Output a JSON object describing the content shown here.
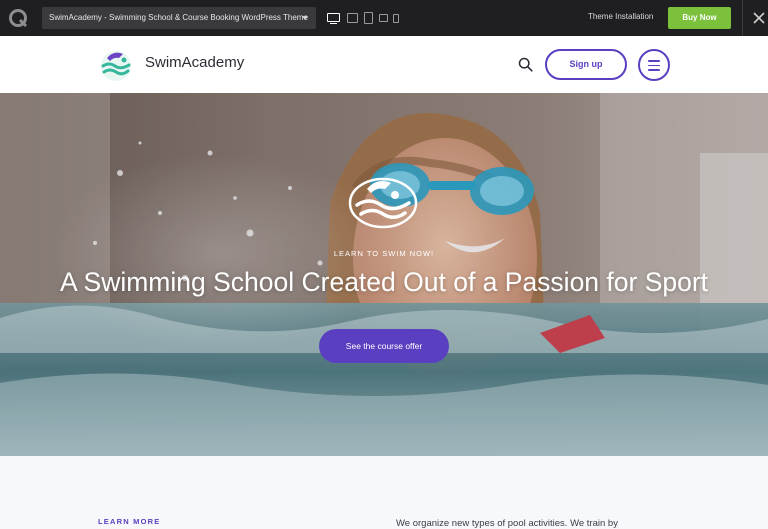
{
  "preview_bar": {
    "theme_name": "SwimAcademy - Swimming School & Course Booking WordPress Theme",
    "theme_installation": "Theme Installation",
    "buy_now": "Buy Now",
    "buy_color": "#7cc13c",
    "icons": [
      "q-logo-icon",
      "chevron-down-icon",
      "desktop-icon",
      "laptop-icon",
      "tablet-icon",
      "tablet-landscape-icon",
      "phone-icon",
      "close-icon"
    ]
  },
  "header": {
    "site_name": "SwimAcademy",
    "sign_up": "Sign up",
    "accent_color": "#5a3fc0",
    "icons": [
      "swimacademy-logo-icon",
      "search-icon",
      "menu-icon"
    ]
  },
  "hero": {
    "eyebrow": "LEARN TO SWIM NOW!",
    "title": "A Swimming School Created Out of a Passion for Sport",
    "cta": "See the course offer"
  },
  "section": {
    "learn_more": "LEARN MORE",
    "intro_text": "We organize new types of pool activities. We train by"
  }
}
